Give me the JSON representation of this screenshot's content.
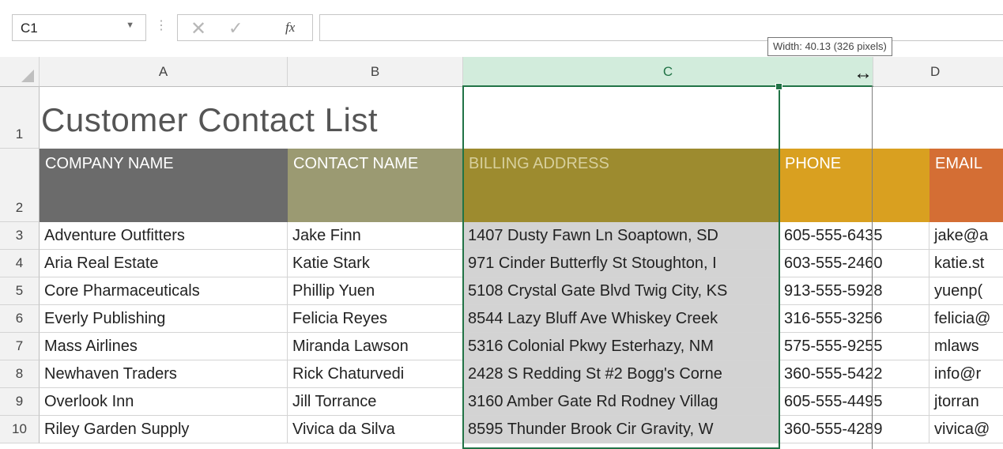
{
  "formula_bar": {
    "name_box": "C1",
    "formula": "",
    "fx_label": "fx"
  },
  "tooltip": "Width: 40.13 (326 pixels)",
  "columns": [
    {
      "letter": "A"
    },
    {
      "letter": "B"
    },
    {
      "letter": "C"
    },
    {
      "letter": "D"
    }
  ],
  "sheet_title": "Customer Contact List",
  "headers": {
    "company": "COMPANY NAME",
    "contact": "CONTACT NAME",
    "billing": "BILLING ADDRESS",
    "phone": "PHONE",
    "email": "EMAIL"
  },
  "header_colors": {
    "company": "#6b6b6b",
    "contact": "#9b9a72",
    "billing": "#9d8b2f",
    "phone": "#d9a020",
    "email": "#d46e34"
  },
  "rows": [
    {
      "num": "1"
    },
    {
      "num": "2"
    },
    {
      "num": "3",
      "company": "Adventure Outfitters",
      "contact": "Jake Finn",
      "billing": "1407 Dusty Fawn Ln Soaptown, SD",
      "phone": "605-555-6435",
      "email": "jake@a"
    },
    {
      "num": "4",
      "company": "Aria Real Estate",
      "contact": "Katie Stark",
      "billing": "971 Cinder Butterfly St Stoughton, I",
      "phone": "603-555-2460",
      "email": "katie.st"
    },
    {
      "num": "5",
      "company": "Core Pharmaceuticals",
      "contact": "Phillip Yuen",
      "billing": "5108 Crystal Gate Blvd Twig City, KS",
      "phone": "913-555-5928",
      "email": "yuenp("
    },
    {
      "num": "6",
      "company": "Everly Publishing",
      "contact": "Felicia Reyes",
      "billing": "8544 Lazy Bluff Ave Whiskey Creek",
      "phone": "316-555-3256",
      "email": "felicia@"
    },
    {
      "num": "7",
      "company": "Mass Airlines",
      "contact": "Miranda Lawson",
      "billing": "5316 Colonial Pkwy Esterhazy, NM",
      "phone": "575-555-9255",
      "email": "mlaws"
    },
    {
      "num": "8",
      "company": "Newhaven Traders",
      "contact": "Rick Chaturvedi",
      "billing": "2428 S Redding St #2 Bogg's Corne",
      "phone": "360-555-5422",
      "email": "info@r"
    },
    {
      "num": "9",
      "company": "Overlook Inn",
      "contact": "Jill Torrance",
      "billing": "3160 Amber Gate Rd Rodney Villag",
      "phone": "605-555-4495",
      "email": "jtorran"
    },
    {
      "num": "10",
      "company": "Riley Garden Supply",
      "contact": "Vivica da Silva",
      "billing": "8595 Thunder Brook Cir Gravity, W",
      "phone": "360-555-4289",
      "email": "vivica@"
    }
  ]
}
